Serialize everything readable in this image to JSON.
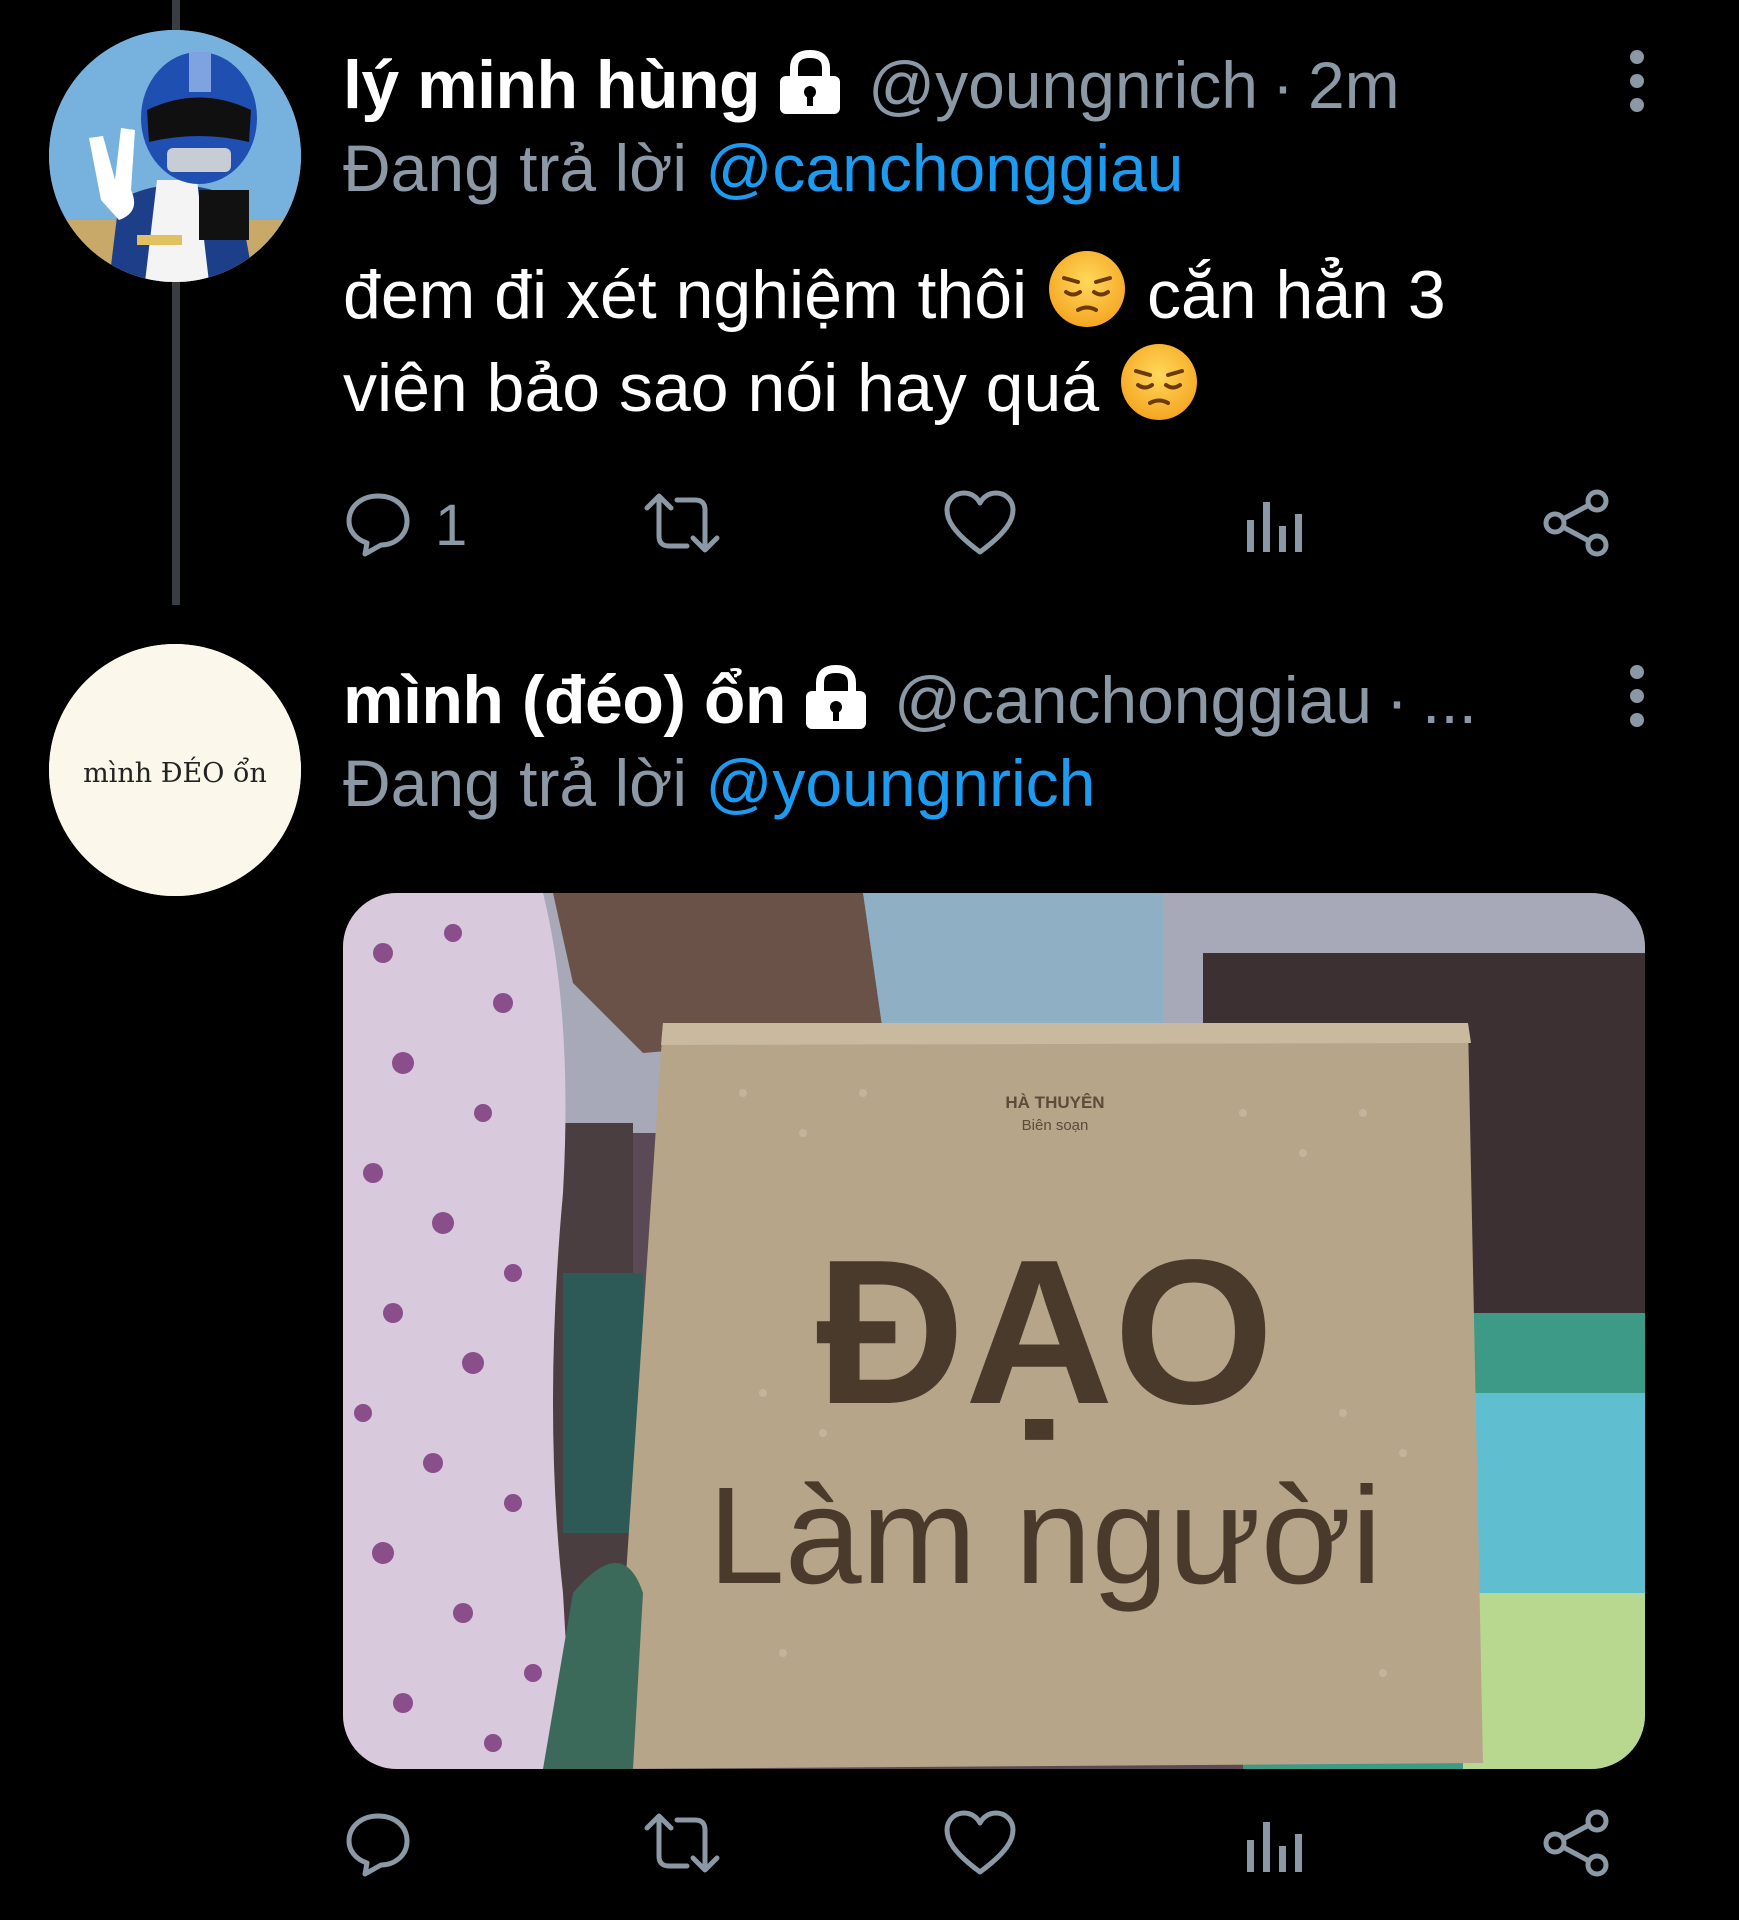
{
  "tweets": [
    {
      "display_name": "lý minh hùng",
      "handle": "@youngnrich",
      "separator": "·",
      "time": "2m",
      "reply_prefix": "Đang trả lời",
      "reply_to": "@canchonggiau",
      "text_line1": "đem đi xét nghiệm thôi",
      "text_line1b": "cắn hẳn 3",
      "text_line2": "viên bảo sao nói hay quá",
      "reply_count": "1"
    },
    {
      "display_name": "mình (đéo) ổn",
      "handle": "@canchonggiau",
      "separator": "·",
      "time": "...",
      "reply_prefix": "Đang trả lời",
      "reply_to": "@youngnrich",
      "avatar_text": "mình ĐÉO ổn",
      "media": {
        "author": "HÀ THUYÊN",
        "author_role": "Biên soạn",
        "book_title_line1": "ĐẠO",
        "book_title_line2": "Làm người"
      }
    }
  ],
  "colors": {
    "background": "#000000",
    "secondary_text": "#8b98a5",
    "mention": "#1d9bf0",
    "thread_line": "#3a3d42"
  },
  "icons": [
    "lock-icon",
    "more-vertical-icon",
    "reply-icon",
    "retweet-icon",
    "like-icon",
    "views-icon",
    "share-icon",
    "pensive-face-emoji"
  ]
}
